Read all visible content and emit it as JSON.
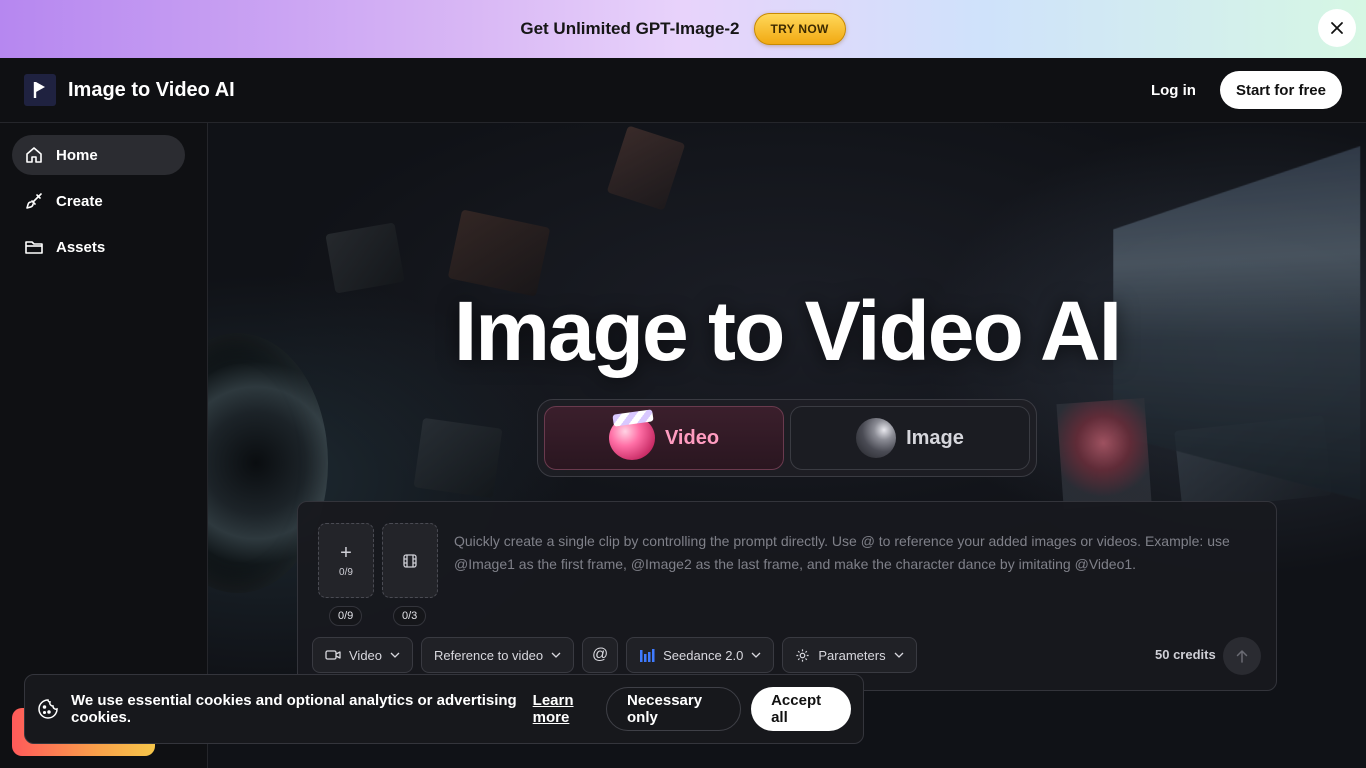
{
  "banner": {
    "text": "Get Unlimited GPT-Image-2",
    "cta": "TRY NOW",
    "close_icon": "close-icon"
  },
  "header": {
    "logo_icon": "play-flag-icon",
    "title": "Image to Video AI",
    "login": "Log in",
    "start": "Start for free"
  },
  "sidebar": {
    "items": [
      {
        "label": "Home",
        "icon": "home-icon",
        "active": true
      },
      {
        "label": "Create",
        "icon": "brush-icon",
        "active": false
      },
      {
        "label": "Assets",
        "icon": "folder-icon",
        "active": false
      }
    ]
  },
  "hero": {
    "title": "Image to Video AI",
    "modes": [
      {
        "label": "Video",
        "active": true
      },
      {
        "label": "Image",
        "active": false
      }
    ]
  },
  "composer": {
    "image_upload_count": "0/9",
    "image_pill": "0/9",
    "video_pill": "0/3",
    "prompt_placeholder": "Quickly create a single clip by controlling the prompt directly. Use @ to reference your added images or videos. Example: use @Image1 as the first frame, @Image2 as the last frame, and make the character dance by imitating @Video1.",
    "toolbar": {
      "type": "Video",
      "mode": "Reference to video",
      "at_symbol": "@",
      "model": "Seedance 2.0",
      "params": "Parameters"
    },
    "credits": "50 credits"
  },
  "cookie": {
    "text": "We use essential cookies and optional analytics or advertising cookies.",
    "learn_more": "Learn more",
    "necessary": "Necessary only",
    "accept": "Accept all"
  },
  "colors": {
    "accent_pink": "#ff9cc0",
    "background": "#0f1013",
    "model_blue": "#3f7bff"
  }
}
